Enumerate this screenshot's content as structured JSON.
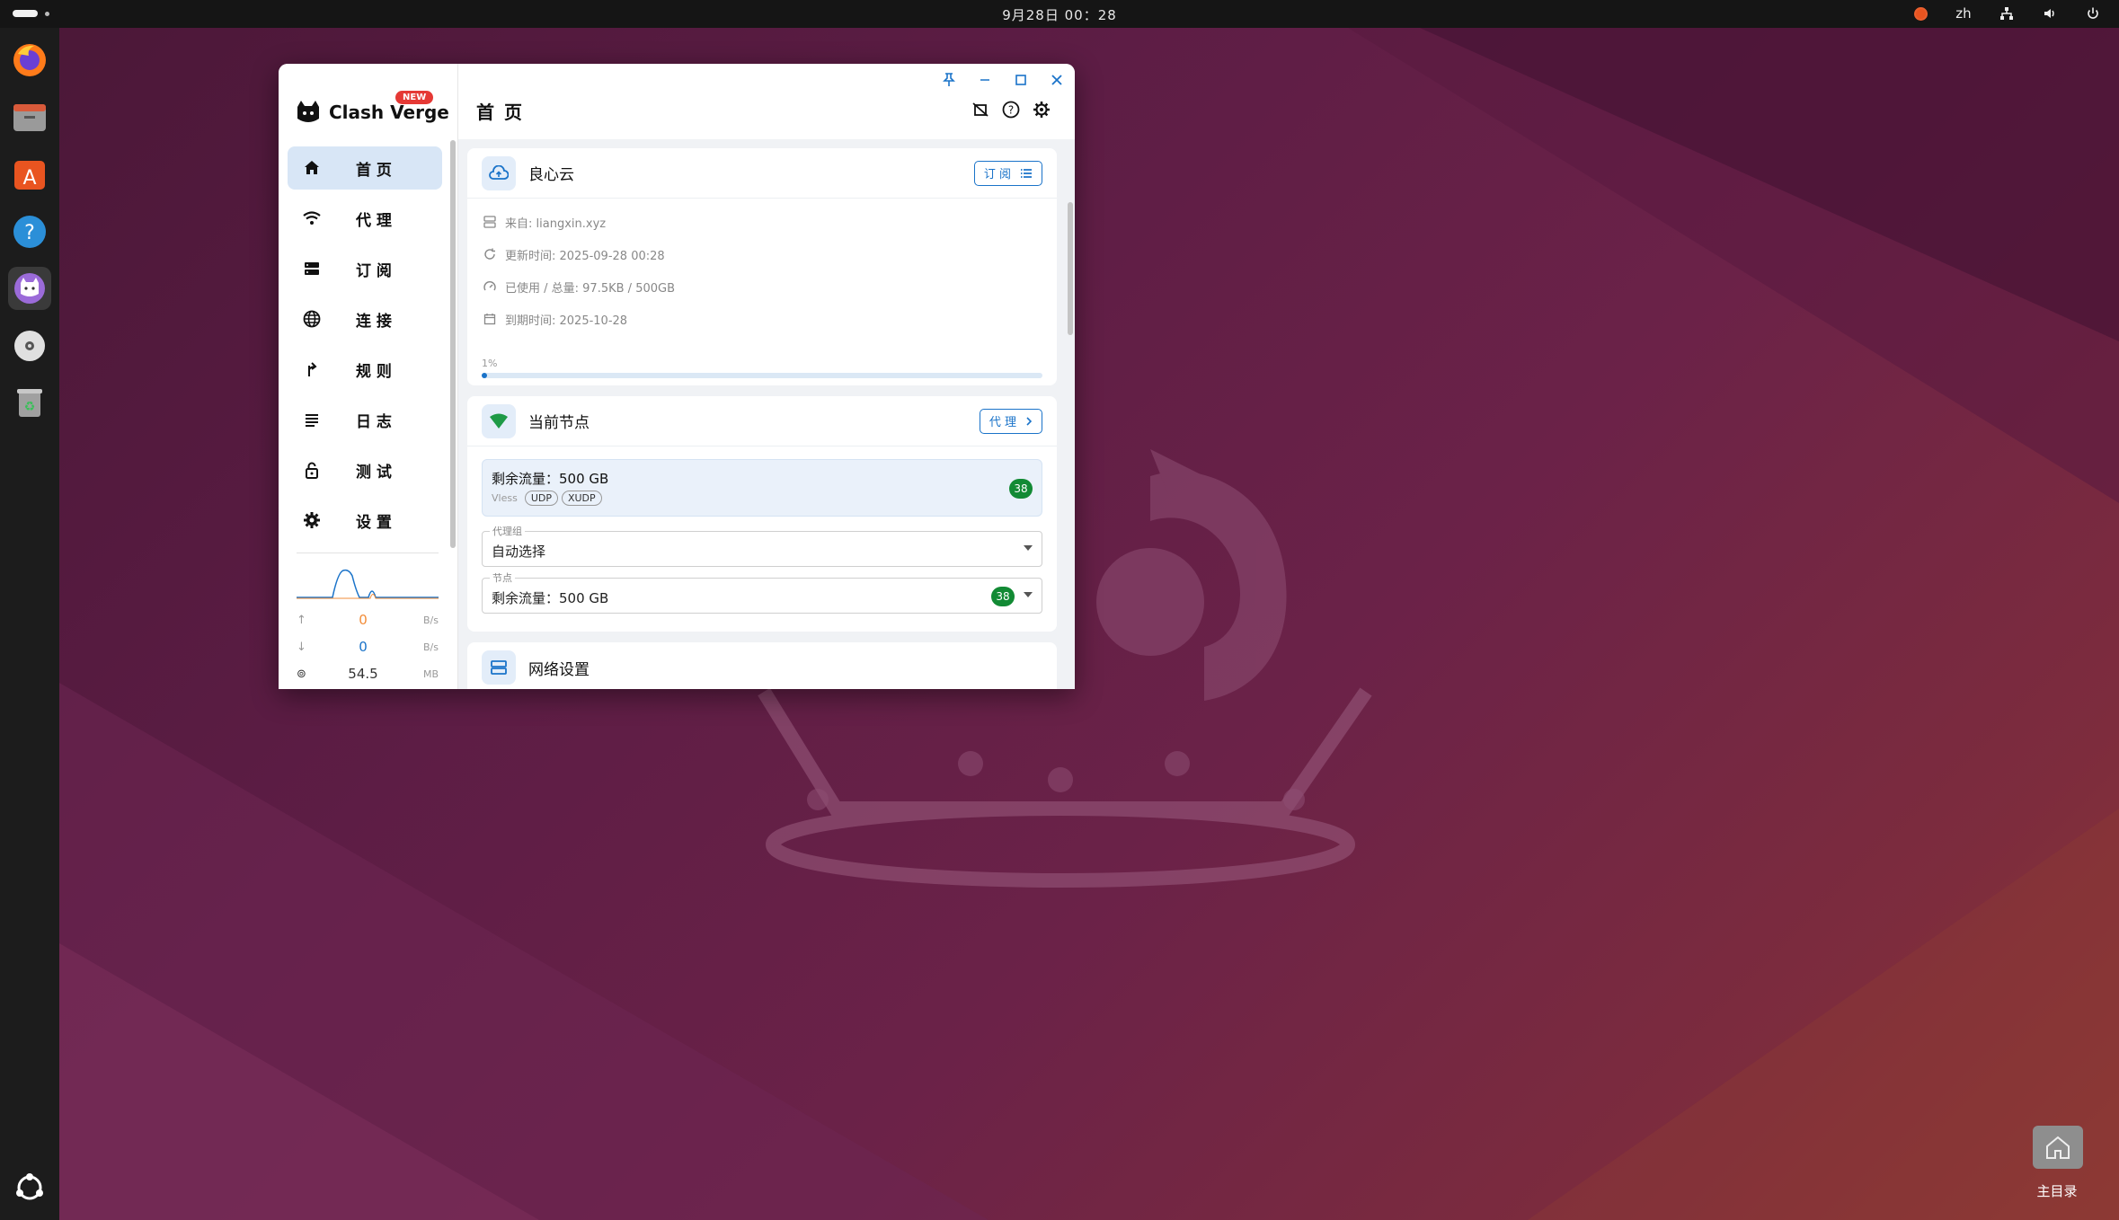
{
  "topbar": {
    "clock": "9月28日 00：28",
    "lang": "zh"
  },
  "window": {
    "app_name": "Clash Verge",
    "new_badge": "NEW",
    "page_title": "首 页",
    "nav": [
      {
        "label": "首 页",
        "icon": "home-icon",
        "active": true
      },
      {
        "label": "代 理",
        "icon": "wifi-icon",
        "active": false
      },
      {
        "label": "订 阅",
        "icon": "storage-icon",
        "active": false
      },
      {
        "label": "连 接",
        "icon": "globe-icon",
        "active": false
      },
      {
        "label": "规 则",
        "icon": "fork-icon",
        "active": false
      },
      {
        "label": "日 志",
        "icon": "list-icon",
        "active": false
      },
      {
        "label": "测 试",
        "icon": "lock-icon",
        "active": false
      },
      {
        "label": "设 置",
        "icon": "gear-icon",
        "active": false
      }
    ],
    "traffic": {
      "up_value": "0",
      "up_unit": "B/s",
      "down_value": "0",
      "down_unit": "B/s",
      "memory_value": "54.5",
      "memory_unit": "MB"
    },
    "profile_card": {
      "title": "良心云",
      "button": "订 阅",
      "from": "来自: liangxin.xyz",
      "updated": "更新时间: 2025-09-28 00:28",
      "usage": "已使用 / 总量: 97.5KB / 500GB",
      "expire": "到期时间: 2025-10-28",
      "progress_label": "1%",
      "progress_fraction": 0.01
    },
    "node_card": {
      "title": "当前节点",
      "button": "代 理",
      "node_name": "剩余流量：500 GB",
      "node_type": "Vless",
      "chips": [
        "UDP",
        "XUDP"
      ],
      "delay": "38",
      "group_legend": "代理组",
      "group_value": "自动选择",
      "node_legend": "节点",
      "node_value": "剩余流量：500 GB",
      "node_delay": "38"
    },
    "network_card": {
      "title": "网络设置"
    }
  },
  "desktop": {
    "home_folder_label": "主目录"
  },
  "colors": {
    "accent": "#1a73c9",
    "delay_green": "#128a34",
    "upload_orange": "#f28c38"
  }
}
